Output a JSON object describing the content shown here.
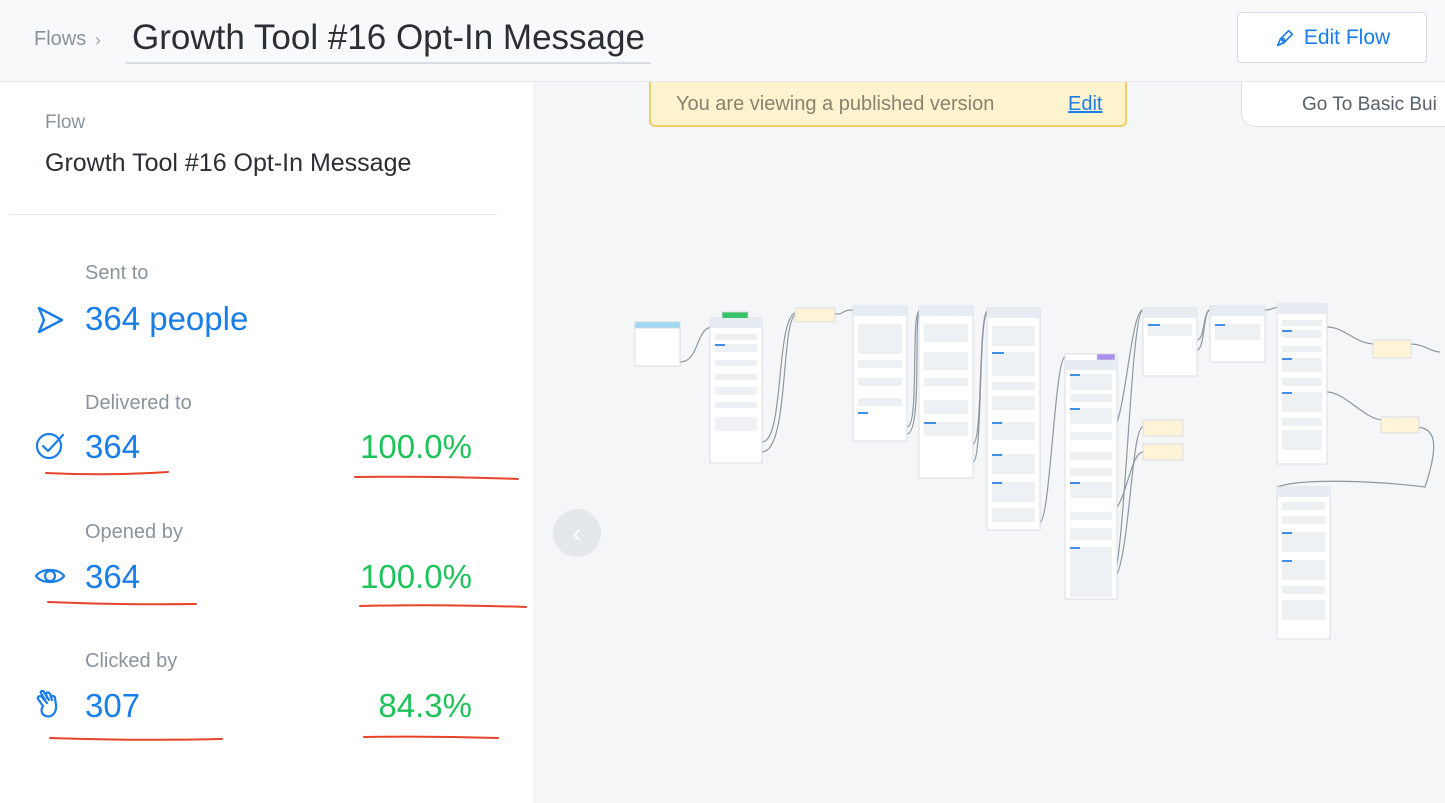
{
  "header": {
    "breadcrumb_root": "Flows",
    "breadcrumb_separator": "›",
    "title": "Growth Tool #16 Opt-In Message",
    "edit_button": "Edit Flow"
  },
  "sidebar": {
    "flow_label": "Flow",
    "flow_name": "Growth Tool #16 Opt-In Message",
    "stats": [
      {
        "label": "Sent to",
        "value": "364 people",
        "percent": "",
        "icon": "send-icon"
      },
      {
        "label": "Delivered to",
        "value": "364",
        "percent": "100.0%",
        "icon": "check-circle-icon"
      },
      {
        "label": "Opened by",
        "value": "364",
        "percent": "100.0%",
        "icon": "eye-icon"
      },
      {
        "label": "Clicked by",
        "value": "307",
        "percent": "84.3%",
        "icon": "hand-click-icon"
      }
    ]
  },
  "canvas": {
    "banner_text": "You are viewing a published version",
    "banner_edit": "Edit",
    "basic_builder_button": "Go To Basic Bui",
    "collapse_button": "‹"
  },
  "colors": {
    "accent": "#1a7ee8",
    "positive": "#1fc35a",
    "annotation": "#e8432b",
    "banner_bg": "#fdf3cf",
    "banner_border": "#f0cf6a"
  }
}
